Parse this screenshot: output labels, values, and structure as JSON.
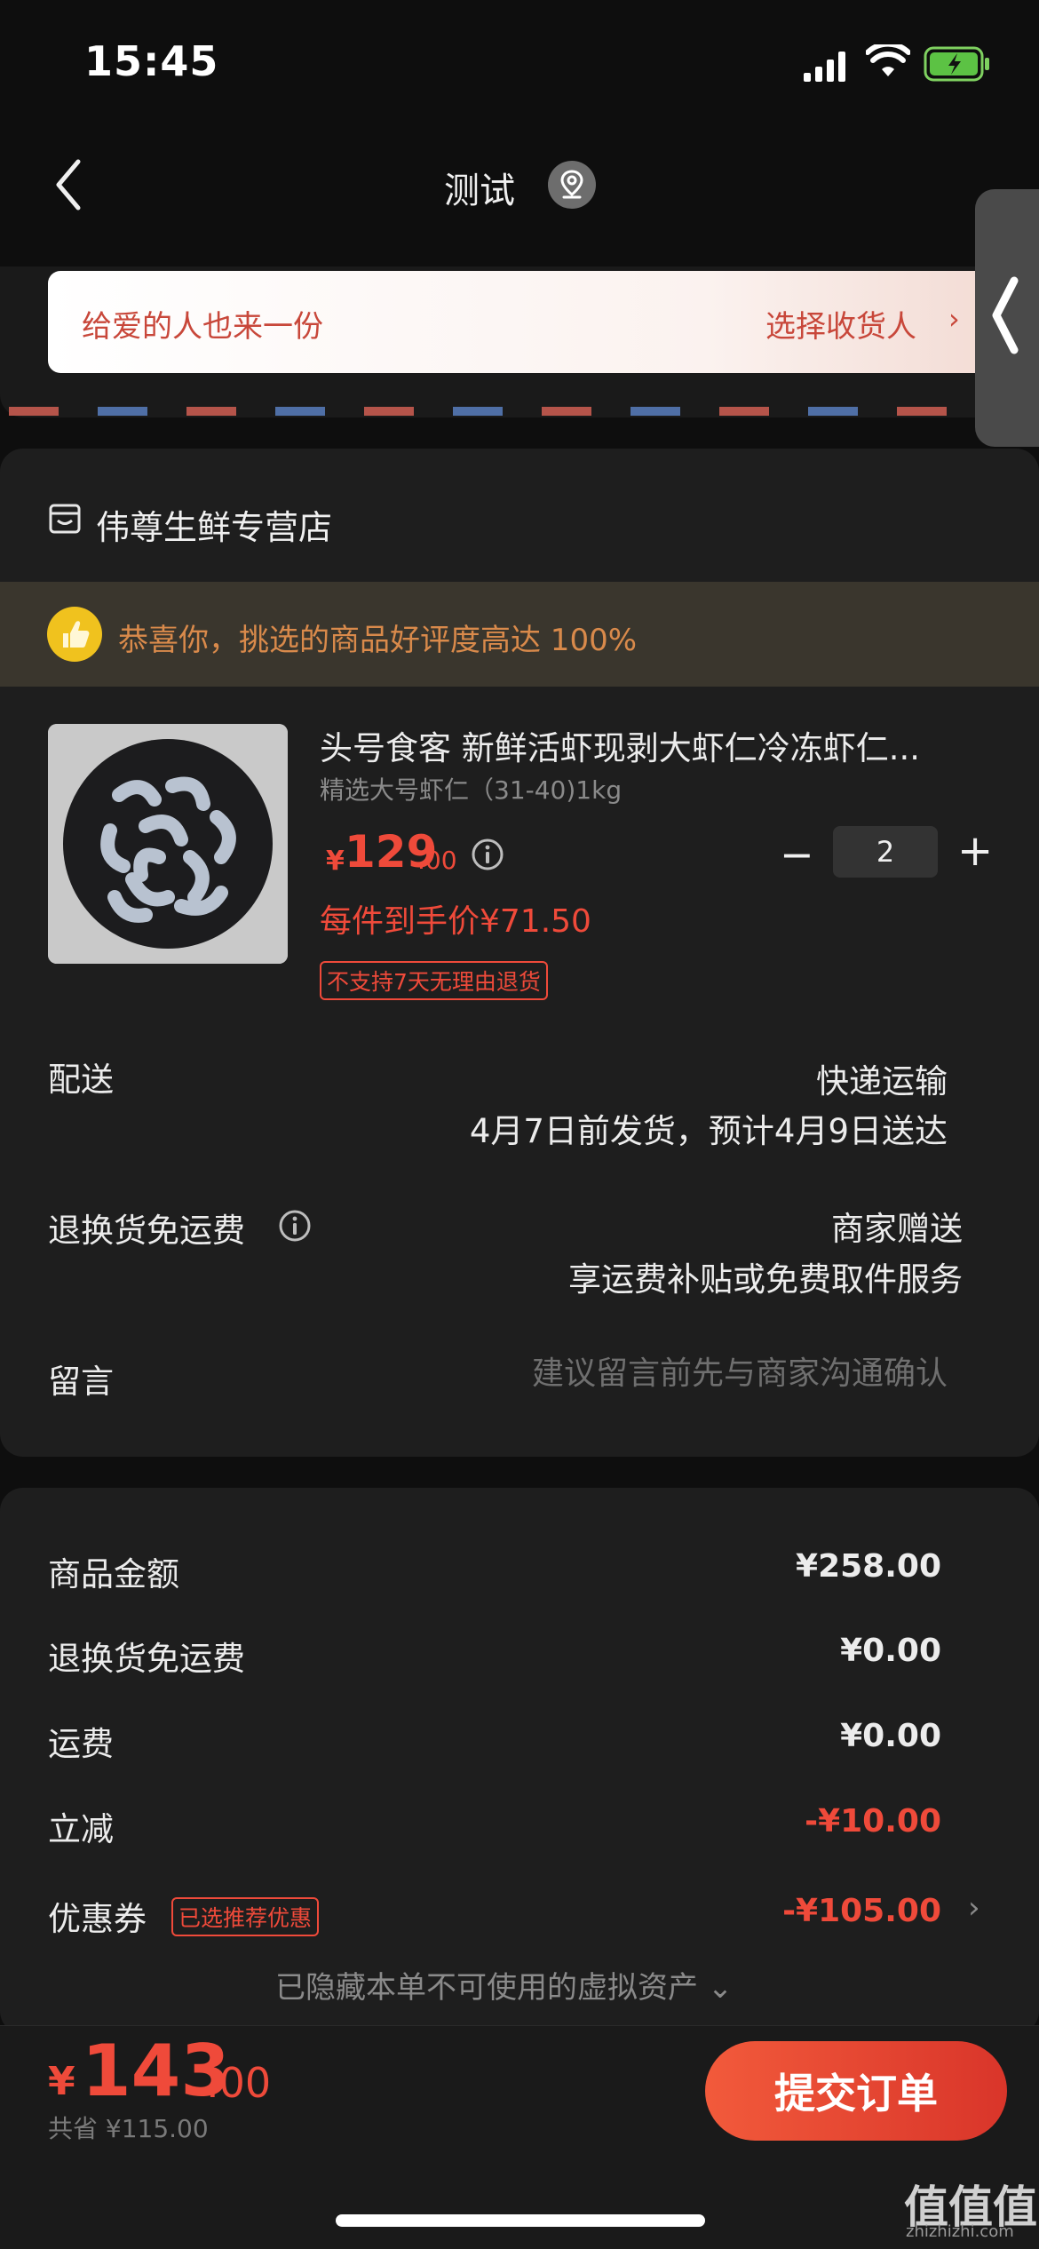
{
  "status": {
    "time": "15:45"
  },
  "nav": {
    "title": "测试"
  },
  "gift": {
    "left_text": "给爱的人也来一份",
    "right_text": "选择收货人",
    "chevron": "›"
  },
  "store": {
    "name": "伟尊生鲜专营店"
  },
  "praise": {
    "text": "恭喜你，挑选的商品好评度高达 100%"
  },
  "product": {
    "title": "头号食客 新鲜活虾现剥大虾仁冷冻虾仁...",
    "spec": "精选大号虾仁（31-40)1kg",
    "price_symbol": "¥",
    "price_int": "129",
    "price_dec": ".00",
    "quantity": "2",
    "unit_price": "每件到手价¥71.50",
    "tag": "不支持7天无理由退货"
  },
  "shipping": {
    "label": "配送",
    "method": "快递运输",
    "eta": "4月7日前发货，预计4月9日送达"
  },
  "returns": {
    "label": "退换货免运费",
    "value1": "商家赠送",
    "value2": "享运费补贴或免费取件服务"
  },
  "message": {
    "label": "留言",
    "placeholder": "建议留言前先与商家沟通确认"
  },
  "summary": {
    "goods_label": "商品金额",
    "goods_value": "¥258.00",
    "return_label": "退换货免运费",
    "return_value": "¥0.00",
    "freight_label": "运费",
    "freight_value": "¥0.00",
    "discount_label": "立减",
    "discount_value": "-¥10.00",
    "coupon_label": "优惠券",
    "coupon_tag": "已选推荐优惠",
    "coupon_value": "-¥105.00",
    "hidden_note": "已隐藏本单不可使用的虚拟资产 ⌄"
  },
  "footer": {
    "total_symbol": "¥",
    "total_int": "143",
    "total_dec": ".00",
    "saved": "共省 ¥115.00",
    "submit": "提交订单"
  },
  "watermark": {
    "main": "值值值",
    "sub": "zhizhizhi.com"
  },
  "colors": {
    "accent": "#ef4a3a",
    "background": "#0e0e0e",
    "card": "#1e1e1e"
  }
}
